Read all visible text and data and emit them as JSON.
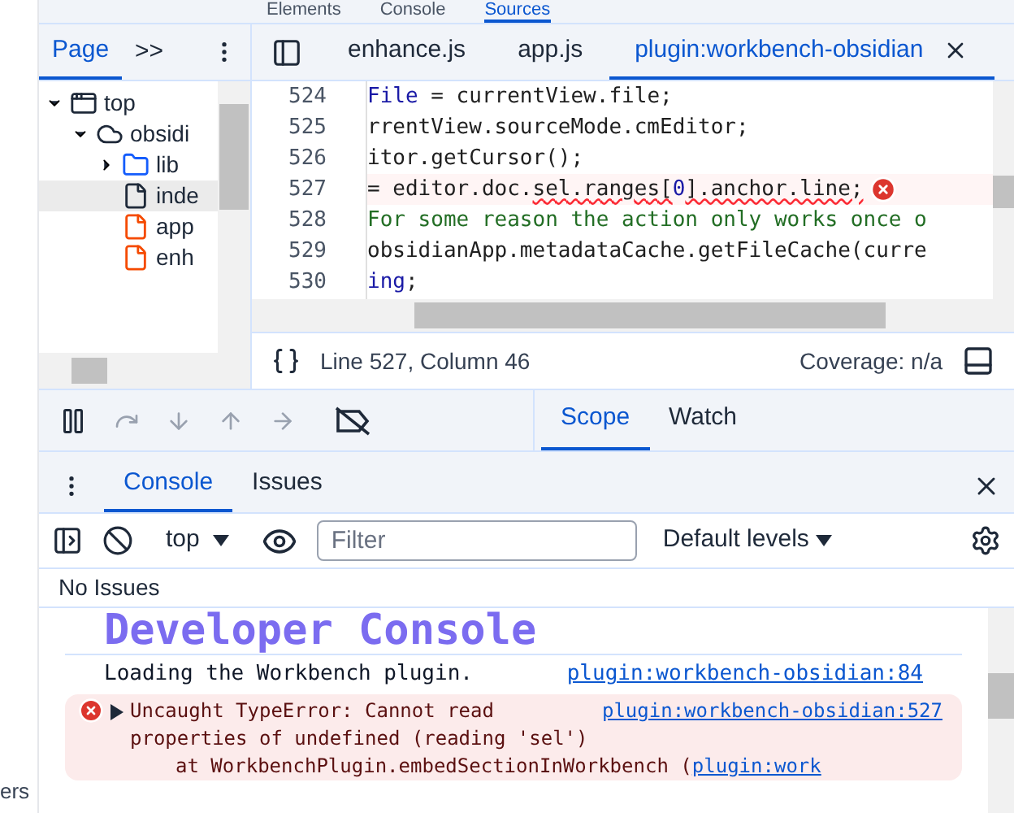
{
  "main_tabs": [
    {
      "label": "Elements",
      "selected": false
    },
    {
      "label": "Console",
      "selected": false
    },
    {
      "label": "Sources",
      "selected": true
    }
  ],
  "navigator": {
    "tabs": [
      {
        "label": "Page",
        "selected": true
      }
    ],
    "more": ">>",
    "tree": [
      {
        "label": "top",
        "kind": "frame",
        "expanded": true,
        "selected": false,
        "children": [
          {
            "label": "obsidi",
            "kind": "domain",
            "expanded": true,
            "selected": false,
            "children": [
              {
                "label": "lib",
                "kind": "folder",
                "expanded": false,
                "selected": false
              },
              {
                "label": "inde",
                "kind": "document",
                "selected": true
              },
              {
                "label": "app",
                "kind": "script",
                "selected": false
              },
              {
                "label": "enh",
                "kind": "script",
                "selected": false
              }
            ]
          }
        ]
      }
    ]
  },
  "editor_tabs": [
    {
      "label": "enhance.js",
      "selected": false
    },
    {
      "label": "app.js",
      "selected": false
    },
    {
      "label": "plugin:workbench-obsidian",
      "selected": true
    }
  ],
  "code": [
    {
      "number": "524",
      "error": false,
      "segments": [
        {
          "text": "File",
          "kind": "keyword"
        },
        {
          "text": " = currentView.file;",
          "kind": "plain"
        }
      ]
    },
    {
      "number": "525",
      "error": false,
      "segments": [
        {
          "text": "rrentView.sourceMode.cmEditor;",
          "kind": "plain"
        }
      ]
    },
    {
      "number": "526",
      "error": false,
      "segments": [
        {
          "text": "itor.getCursor();",
          "kind": "plain"
        }
      ]
    },
    {
      "number": "527",
      "error": true,
      "segments": [
        {
          "text": " = editor.doc.",
          "kind": "plain"
        },
        {
          "text": "sel.ranges[",
          "kind": "error"
        },
        {
          "text": "0",
          "kind": "number"
        },
        {
          "text": "].anchor.line;",
          "kind": "error"
        }
      ]
    },
    {
      "number": "528",
      "error": false,
      "segments": [
        {
          "text": "For some reason the action only works once o",
          "kind": "comment"
        }
      ]
    },
    {
      "number": "529",
      "error": false,
      "segments": [
        {
          "text": "obsidianApp.metadataCache.getFileCache(curre",
          "kind": "plain"
        }
      ]
    },
    {
      "number": "530",
      "error": false,
      "segments": [
        {
          "text": "ing",
          "kind": "keyword"
        },
        {
          "text": ";",
          "kind": "plain"
        }
      ]
    }
  ],
  "status_bar": {
    "position": "Line 527, Column 46",
    "coverage": "Coverage: n/a"
  },
  "sidebar_tabs": [
    {
      "label": "Scope",
      "selected": true
    },
    {
      "label": "Watch",
      "selected": false
    }
  ],
  "drawer_tabs": [
    {
      "label": "Console",
      "selected": true
    },
    {
      "label": "Issues",
      "selected": false
    }
  ],
  "console_toolbar": {
    "context": "top",
    "filter_placeholder": "Filter",
    "levels": "Default levels"
  },
  "issues_banner": "No Issues",
  "console_messages": [
    {
      "kind": "heading",
      "text": "Developer Console"
    },
    {
      "kind": "log",
      "text": "Loading the Workbench plugin.",
      "source": "plugin:workbench-obsidian:84"
    },
    {
      "kind": "error",
      "text": "Uncaught TypeError: Cannot read properties of undefined (reading 'sel')",
      "source": "plugin:workbench-obsidian:527",
      "trace": "at WorkbenchPlugin.embedSectionInWorkbench (",
      "trace_link": "plugin:work"
    }
  ],
  "background_text": "ers"
}
